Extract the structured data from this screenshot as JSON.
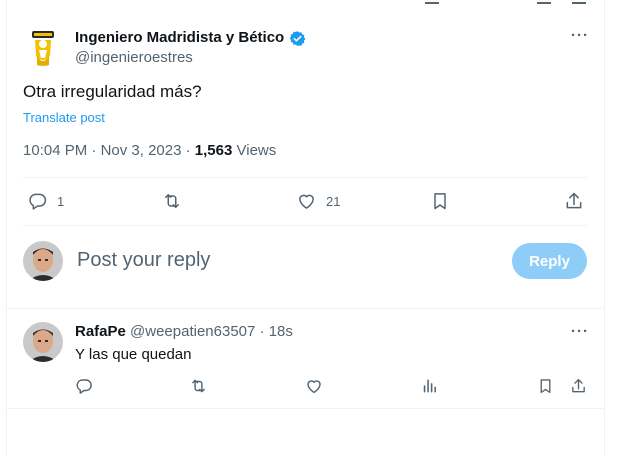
{
  "tweet": {
    "author_name": "Ingeniero Madridista y Bético",
    "author_handle": "@ingenieroestres",
    "text": "Otra irregularidad más?",
    "translate_label": "Translate post",
    "time": "10:04 PM",
    "date": "Nov 3, 2023",
    "views_count": "1,563",
    "views_label": "Views",
    "replies_count": "1",
    "likes_count": "21",
    "more_icon": "more-icon",
    "verified_color": "#1d9bf0"
  },
  "composer": {
    "placeholder": "Post your reply",
    "reply_button": "Reply"
  },
  "reply": {
    "author_name": "RafaPe",
    "author_handle": "@weepatien63507",
    "time": "18s",
    "text": "Y las que quedan"
  },
  "colors": {
    "accent": "#1d9bf0",
    "reply_button_disabled": "#8ecdf8",
    "muted_text": "#536471",
    "divider": "#eff3f4"
  }
}
